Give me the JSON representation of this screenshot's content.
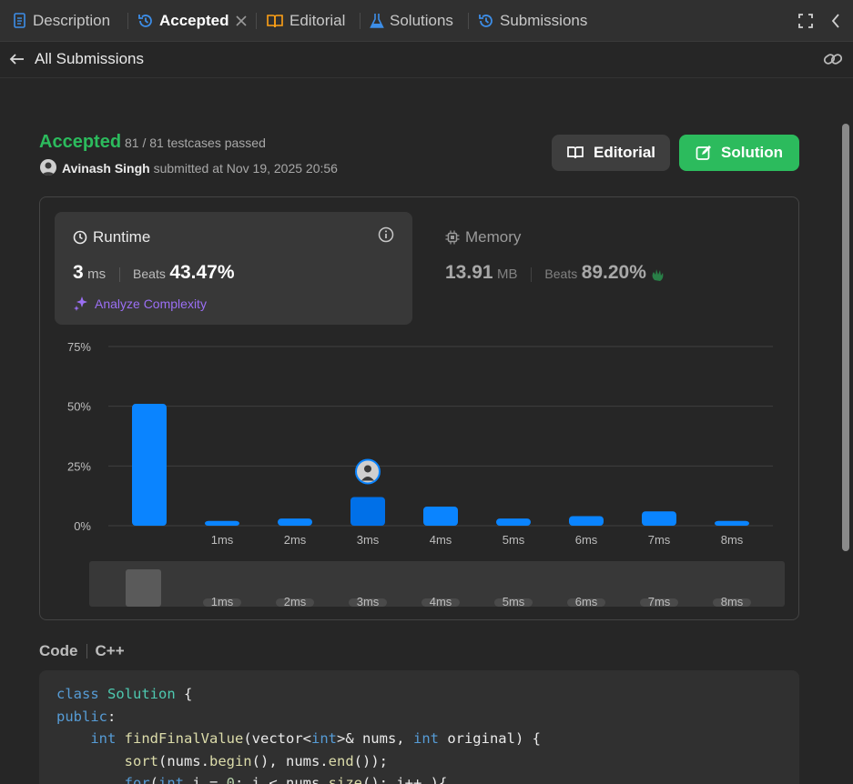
{
  "tabs": [
    {
      "label": "Description",
      "icon": "document-icon",
      "color": "#3d8ee8"
    },
    {
      "label": "Accepted",
      "icon": "history-icon",
      "color": "#3d8ee8"
    },
    {
      "label": "Editorial",
      "icon": "book-icon",
      "color": "#ffa116"
    },
    {
      "label": "Solutions",
      "icon": "flask-icon",
      "color": "#3d8ee8"
    },
    {
      "label": "Submissions",
      "icon": "history-icon",
      "color": "#3d8ee8"
    }
  ],
  "subheader": {
    "back_label": "All Submissions"
  },
  "submission": {
    "status": "Accepted",
    "testcases": "81 / 81 testcases passed",
    "author": "Avinash Singh",
    "submitted_text": " submitted at Nov 19, 2025 20:56"
  },
  "buttons": {
    "editorial": "Editorial",
    "solution": "Solution"
  },
  "runtime": {
    "title": "Runtime",
    "value": "3",
    "unit": "ms",
    "beats_label": "Beats",
    "beats_value": "43.47%",
    "analyze_label": "Analyze Complexity"
  },
  "memory": {
    "title": "Memory",
    "value": "13.91",
    "unit": "MB",
    "beats_label": "Beats",
    "beats_value": "89.20%"
  },
  "chart_data": {
    "type": "bar",
    "categories": [
      "",
      "1ms",
      "2ms",
      "3ms",
      "4ms",
      "5ms",
      "6ms",
      "7ms",
      "8ms"
    ],
    "values": [
      51,
      2,
      3,
      12,
      8,
      3,
      4,
      6,
      2
    ],
    "highlight_index": 3,
    "yticks": [
      "75%",
      "50%",
      "25%",
      "0%"
    ],
    "ylim": [
      0,
      75
    ],
    "grid": true,
    "colors": {
      "bar": "#0a84ff",
      "highlight": "#0070e8"
    }
  },
  "overview": {
    "categories": [
      "1ms",
      "2ms",
      "3ms",
      "4ms",
      "5ms",
      "6ms",
      "7ms",
      "8ms"
    ]
  },
  "code": {
    "label": "Code",
    "language": "C++"
  },
  "colors": {
    "accent_green": "#2cbb5d",
    "accent_blue": "#0a84ff"
  }
}
